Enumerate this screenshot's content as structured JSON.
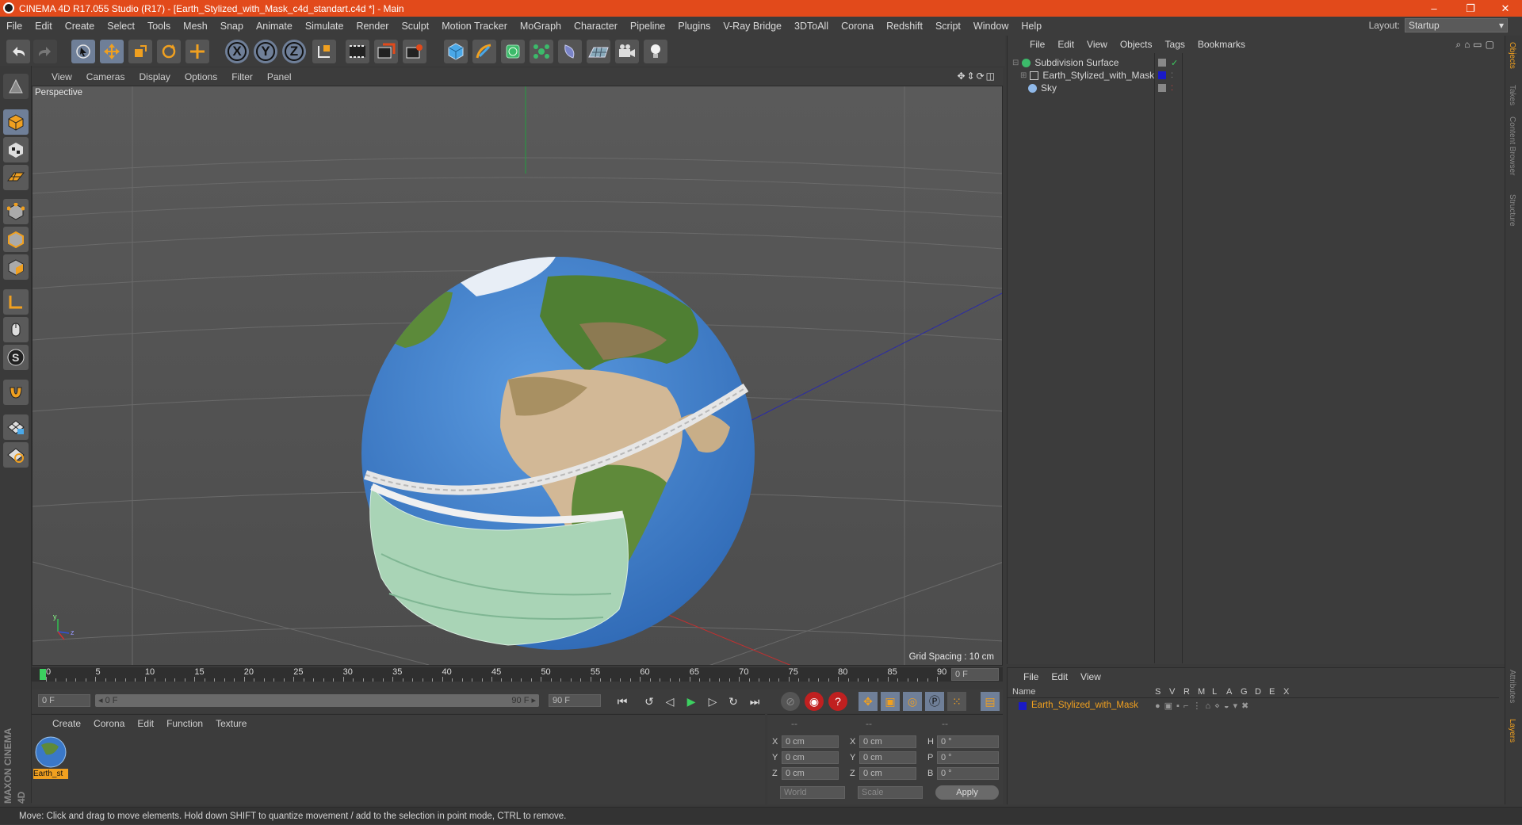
{
  "window": {
    "title": "CINEMA 4D R17.055 Studio (R17) - [Earth_Stylized_with_Mask_c4d_standart.c4d *] - Main",
    "controls": [
      "–",
      "❐",
      "✕"
    ]
  },
  "menubar": {
    "items": [
      "File",
      "Edit",
      "Create",
      "Select",
      "Tools",
      "Mesh",
      "Snap",
      "Animate",
      "Simulate",
      "Render",
      "Sculpt",
      "Motion Tracker",
      "MoGraph",
      "Character",
      "Pipeline",
      "Plugins",
      "V-Ray Bridge",
      "3DToAll",
      "Corona",
      "Redshift",
      "Script",
      "Window",
      "Help"
    ],
    "layout_label": "Layout:",
    "layout_value": "Startup"
  },
  "toolbar": {
    "axis_x": "X",
    "axis_y": "Y",
    "axis_z": "Z"
  },
  "viewport": {
    "menu": [
      "View",
      "Cameras",
      "Display",
      "Options",
      "Filter",
      "Panel"
    ],
    "label": "Perspective",
    "grid_spacing": "Grid Spacing : 10 cm",
    "axis_y": "y",
    "axis_z": "z"
  },
  "timeline": {
    "ticks": [
      "0",
      "5",
      "10",
      "15",
      "20",
      "25",
      "30",
      "35",
      "40",
      "45",
      "50",
      "55",
      "60",
      "65",
      "70",
      "75",
      "80",
      "85",
      "90"
    ],
    "current_frame": "0 F"
  },
  "playbar": {
    "start_field": "0 F",
    "range_start": "◂ 0 F",
    "range_end": "90 F ▸",
    "end_field": "90 F"
  },
  "material_manager": {
    "menu": [
      "Create",
      "Corona",
      "Edit",
      "Function",
      "Texture"
    ],
    "material_label": "Earth_st"
  },
  "coordinates": {
    "headers": [
      "--",
      "--",
      "--"
    ],
    "rows": [
      {
        "a": "X",
        "av": "0 cm",
        "b": "X",
        "bv": "0 cm",
        "c": "H",
        "cv": "0 °"
      },
      {
        "a": "Y",
        "av": "0 cm",
        "b": "Y",
        "bv": "0 cm",
        "c": "P",
        "cv": "0 °"
      },
      {
        "a": "Z",
        "av": "0 cm",
        "b": "Z",
        "bv": "0 cm",
        "c": "B",
        "cv": "0 °"
      }
    ],
    "space": "World",
    "mode": "Scale",
    "apply": "Apply"
  },
  "object_manager": {
    "menu": [
      "File",
      "Edit",
      "View",
      "Objects",
      "Tags",
      "Bookmarks"
    ],
    "objects": [
      {
        "name": "Subdivision Surface"
      },
      {
        "name": "Earth_Stylized_with_Mask"
      },
      {
        "name": "Sky"
      }
    ]
  },
  "layer_manager": {
    "menu": [
      "File",
      "Edit",
      "View"
    ],
    "columns": [
      "Name",
      "S",
      "V",
      "R",
      "M",
      "L",
      "A",
      "G",
      "D",
      "E",
      "X"
    ],
    "layer_name": "Earth_Stylized_with_Mask"
  },
  "side_tabs": [
    "Objects",
    "Takes",
    "Content Browser",
    "Structure"
  ],
  "side_tabs_bottom": [
    "Attributes",
    "Layers"
  ],
  "brand": "MAXON CINEMA 4D",
  "status": "Move: Click and drag to move elements. Hold down SHIFT to quantize movement / add to the selection in point mode, CTRL to remove.",
  "colors": {
    "titlebar": "#e24a1b",
    "accent": "#f0a020",
    "selection": "#6f7f98"
  }
}
